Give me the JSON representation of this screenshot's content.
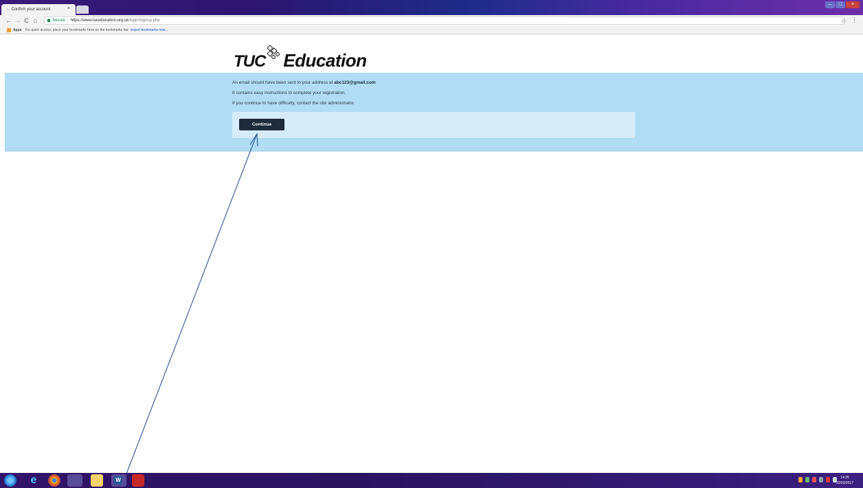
{
  "browser": {
    "tab_title": "Confirm your account",
    "tab_close": "×",
    "back": "←",
    "forward": "→",
    "reload": "C",
    "home": "⌂",
    "secure_label": "Secure",
    "url_host": "https://www.tuceducation.org.uk",
    "url_path": "/login/signup.php",
    "star": "☆",
    "menu": "⋮",
    "window_controls": [
      "–",
      "□",
      "×"
    ],
    "bookmarks": {
      "apps_label": "Apps",
      "hint": "For quick access, place your bookmarks here on the bookmarks bar.",
      "import_link": "Import bookmarks now..."
    }
  },
  "logo": {
    "left": "TUC",
    "right": "Education"
  },
  "page": {
    "line1_prefix": "An email should have been sent to your address at",
    "line1_email": "abc123@gmail.com",
    "line2": "It contains easy instructions to complete your registration.",
    "line3": "If you continue to have difficulty, contact the site administrator.",
    "continue_label": "Continue"
  },
  "taskbar": {
    "items": [
      "start-orb",
      "internet-explorer",
      "chrome",
      "chrome-active",
      "file-explorer",
      "word",
      "acrobat"
    ],
    "clock_time": "14:26",
    "clock_date": "23/03/2017"
  },
  "colors": {
    "band": "#b0dcf4",
    "action_box": "#d6ecf8",
    "button": "#1d2b3a",
    "arrow": "#2f5597"
  }
}
